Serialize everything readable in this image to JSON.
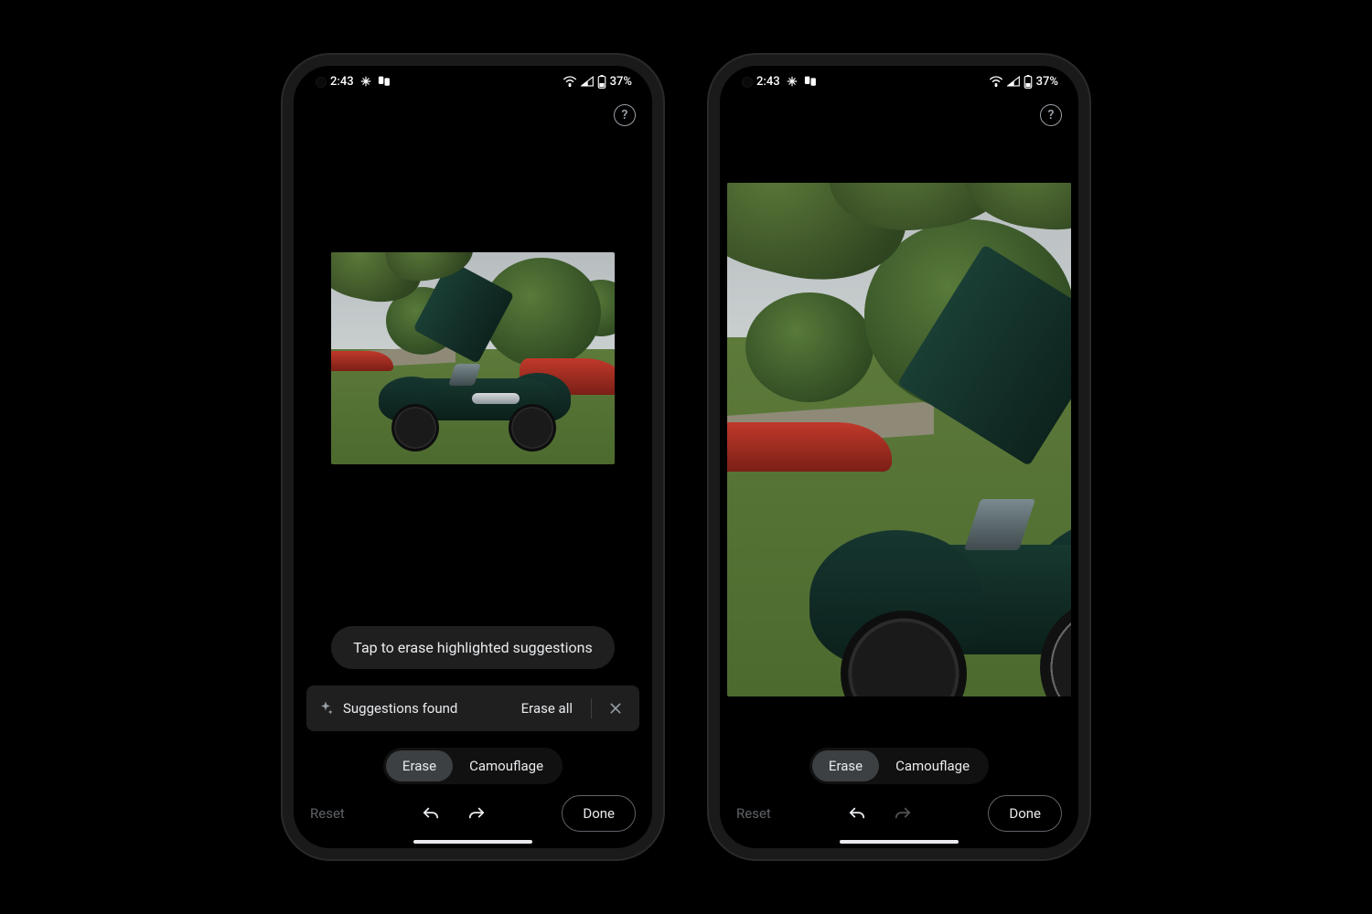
{
  "status": {
    "time": "2:43",
    "battery": "37%"
  },
  "help": {
    "glyph": "?"
  },
  "phone1": {
    "hint": "Tap to erase highlighted suggestions",
    "suggestions": {
      "label": "Suggestions found",
      "erase_all": "Erase all"
    },
    "modes": {
      "erase": "Erase",
      "camouflage": "Camouflage"
    },
    "bottom": {
      "reset": "Reset",
      "done": "Done"
    },
    "undo_enabled": true,
    "redo_enabled": true
  },
  "phone2": {
    "modes": {
      "erase": "Erase",
      "camouflage": "Camouflage"
    },
    "bottom": {
      "reset": "Reset",
      "done": "Done"
    },
    "undo_enabled": true,
    "redo_enabled": false
  }
}
